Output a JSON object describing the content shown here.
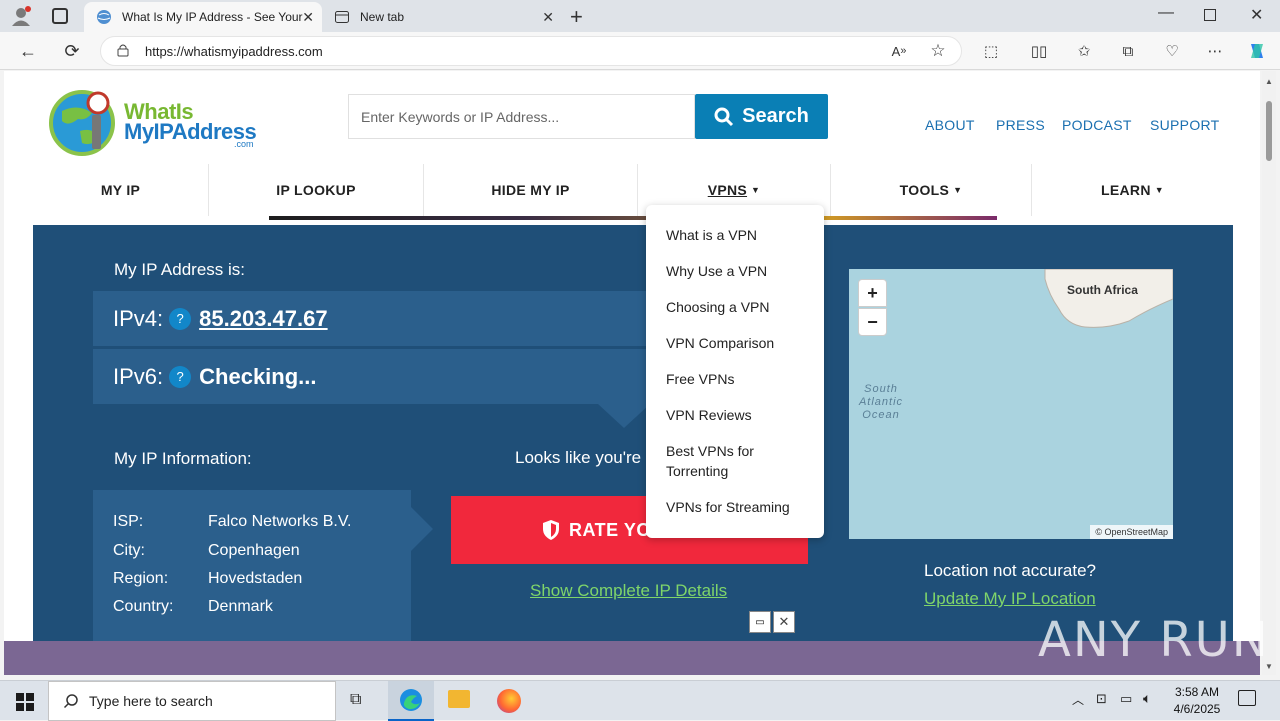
{
  "browser": {
    "tabs": [
      {
        "label": "What Is My IP Address - See Your",
        "active": true
      },
      {
        "label": "New tab",
        "active": false
      }
    ],
    "url": "https://whatismyipaddress.com",
    "url_host": "whatismyipaddress.com",
    "url_scheme": "https://"
  },
  "site": {
    "logo_line1": "WhatIs",
    "logo_line2": "MyIPAddress",
    "logo_suffix": ".com",
    "search_placeholder": "Enter Keywords or IP Address...",
    "search_button": "Search",
    "top_links": [
      "ABOUT",
      "PRESS",
      "PODCAST",
      "SUPPORT"
    ],
    "nav": [
      {
        "label": "MY IP",
        "arrow": ""
      },
      {
        "label": "IP LOOKUP",
        "arrow": ""
      },
      {
        "label": "HIDE MY IP",
        "arrow": ""
      },
      {
        "label": "VPNS",
        "arrow": "▼"
      },
      {
        "label": "TOOLS",
        "arrow": "▼"
      },
      {
        "label": "LEARN",
        "arrow": "▼"
      }
    ],
    "vpn_menu": [
      "What is a VPN",
      "Why Use a VPN",
      "Choosing a VPN",
      "VPN Comparison",
      "Free VPNs",
      "VPN Reviews",
      "Best VPNs for Torrenting",
      "VPNs for Streaming"
    ]
  },
  "ip": {
    "heading": "My IP Address is:",
    "ipv4_label": "IPv4:",
    "ipv4_value": "85.203.47.67",
    "ipv6_label": "IPv6:",
    "ipv6_value": "Checking...",
    "qmark": "?"
  },
  "info": {
    "heading": "My IP Information:",
    "rows": [
      {
        "key": "ISP:",
        "value": "Falco Networks B.V."
      },
      {
        "key": "City:",
        "value": "Copenhagen"
      },
      {
        "key": "Region:",
        "value": "Hovedstaden"
      },
      {
        "key": "Country:",
        "value": "Denmark"
      }
    ]
  },
  "rate": {
    "looks_like": "Looks like you're",
    "button": "RATE YO",
    "details_link": "Show Complete IP Details"
  },
  "map": {
    "zoom_in": "+",
    "zoom_out": "−",
    "label_land": "South Africa",
    "label_ocean": "South Atlantic Ocean",
    "attribution": "© OpenStreetMap"
  },
  "location": {
    "not_accurate": "Location not accurate?",
    "update_link": "Update My IP Location"
  },
  "watermark": "ANY RUN",
  "taskbar": {
    "search_placeholder": "Type here to search",
    "time": "3:58 AM",
    "date": "4/6/2025"
  },
  "colors": {
    "panel_bg": "#1f4f78",
    "panel_row": "#2b5f8c",
    "accent_blue": "#0a7fb5",
    "link_blue": "#1a6fb0",
    "rate_red": "#f1283c",
    "green_link": "#7fd56a"
  }
}
